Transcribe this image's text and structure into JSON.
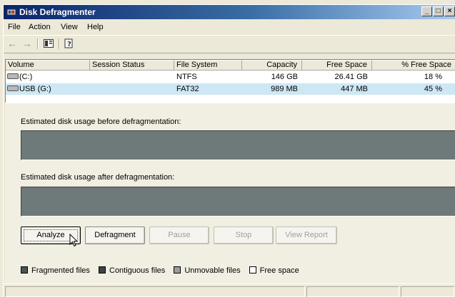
{
  "window": {
    "title": "Disk Defragmenter",
    "min_btn": "_",
    "max_btn": "□",
    "close_btn": "×"
  },
  "menu": [
    "File",
    "Action",
    "View",
    "Help"
  ],
  "toolbar": {
    "back_icon": "back-arrow-icon",
    "forward_icon": "forward-arrow-icon",
    "console_icon": "console-tree-icon",
    "help_icon": "help-icon"
  },
  "volumes": {
    "columns": [
      "Volume",
      "Session Status",
      "File System",
      "Capacity",
      "Free Space",
      "% Free Space"
    ],
    "rows": [
      {
        "volume": "(C:)",
        "status": "",
        "fs": "NTFS",
        "capacity": "146 GB",
        "free": "26.41 GB",
        "pct": "18 %"
      },
      {
        "volume": "USB (G:)",
        "status": "",
        "fs": "FAT32",
        "capacity": "989 MB",
        "free": "447 MB",
        "pct": "45 %"
      }
    ]
  },
  "panel": {
    "before_label": "Estimated disk usage before defragmentation:",
    "after_label": "Estimated disk usage after defragmentation:"
  },
  "buttons": {
    "analyze": "Analyze",
    "defragment": "Defragment",
    "pause": "Pause",
    "stop": "Stop",
    "view_report": "View Report"
  },
  "legend": {
    "fragmented": "Fragmented files",
    "contiguous": "Contiguous files",
    "unmovable": "Unmovable files",
    "free": "Free space"
  },
  "colors": {
    "titlebar_start": "#0a246a",
    "titlebar_end": "#a6caf0",
    "usage_bar": "#6e7a7a",
    "fragmented": "#4a5454",
    "contiguous": "#3a4444",
    "unmovable": "#9a9e9e",
    "free": "#ffffff",
    "selected_row": "#cde7f4"
  }
}
